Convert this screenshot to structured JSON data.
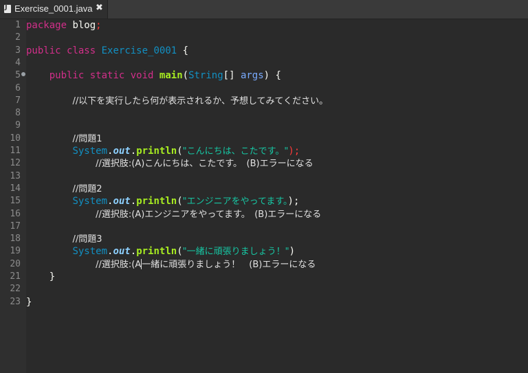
{
  "tab": {
    "title": "Exercise_0001.java",
    "close": "✖"
  },
  "line_numbers": [
    "1",
    "2",
    "3",
    "4",
    "5",
    "6",
    "7",
    "8",
    "9",
    "10",
    "11",
    "12",
    "13",
    "14",
    "15",
    "16",
    "17",
    "18",
    "19",
    "20",
    "21",
    "22",
    "23"
  ],
  "code": {
    "l1_kw": "package",
    "l1_name": " blog",
    "l1_semi": ";",
    "l3_kw1": "public",
    "l3_kw2": "class",
    "l3_name": "Exercise_0001",
    "l3_brace": " {",
    "l5_kw1": "public",
    "l5_kw2": "static",
    "l5_kw3": "void",
    "l5_method": "main",
    "l5_paren": "(",
    "l5_type": "String",
    "l5_arr": "[] ",
    "l5_arg": "args",
    "l5_close": ") {",
    "l7_comment": "//以下を実行したら何が表示されるか、予想してみてください。",
    "l10_comment": "//問題1",
    "l11_sys": "System",
    "l11_dot1": ".",
    "l11_out": "out",
    "l11_dot2": ".",
    "l11_println": "println",
    "l11_open": "(",
    "l11_str": "\"こんにちは、こたです。\"",
    "l11_close": ");",
    "l12_comment": "//選択肢:(A)こんにちは、こたです。　(B)エラーになる",
    "l14_comment": "//問題2",
    "l15_sys": "System",
    "l15_out": "out",
    "l15_println": "println",
    "l15_open": "(",
    "l15_str": "\"エンジニアをやってます。",
    "l15_close": ");",
    "l16_comment": "//選択肢:(A)エンジニアをやってます。　(B)エラーになる",
    "l18_comment": "//問題3",
    "l19_sys": "System",
    "l19_out": "out",
    "l19_println": "println",
    "l19_open": "(",
    "l19_str": "\"一緒に頑張りましょう！\"",
    "l19_close": ")",
    "l20_comment_a": "//選択肢:(A",
    "l20_comment_b": "一緒に頑張りましょう！　(B)エラーになる",
    "l21_brace": "}",
    "l23_brace": "}"
  }
}
